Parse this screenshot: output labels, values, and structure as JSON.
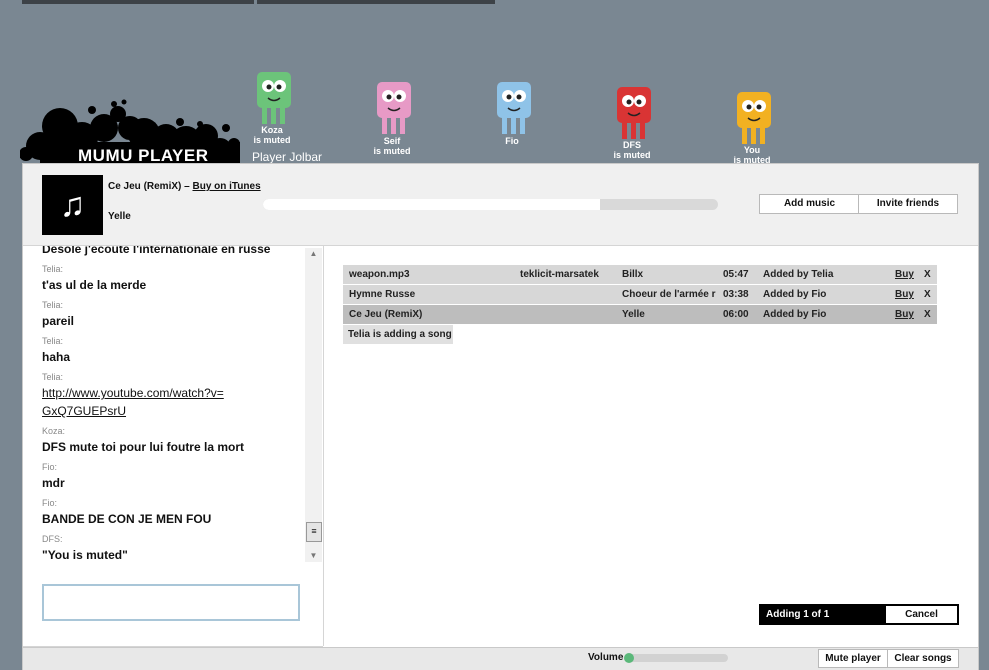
{
  "header": {
    "logo_text": "MUMU PLAYER",
    "room_name": "Player Jolbar"
  },
  "avatars": [
    {
      "name": "Koza",
      "status": "is muted",
      "color": "#6cc47a"
    },
    {
      "name": "Seif",
      "status": "is muted",
      "color": "#e79ac6"
    },
    {
      "name": "Fio",
      "status": "",
      "color": "#8fc3e8"
    },
    {
      "name": "DFS",
      "status": "is muted",
      "color": "#d93434"
    },
    {
      "name": "You",
      "status": "is muted",
      "color": "#f2b122"
    }
  ],
  "now_playing": {
    "track": "Ce Jeu (RemiX)",
    "separator": " – ",
    "buy_link": "Buy on iTunes",
    "artist": "Yelle",
    "album_icon": "music-note-icon",
    "progress": 0.74
  },
  "toolbar": {
    "add_music": "Add music",
    "invite_friends": "Invite friends"
  },
  "chat": {
    "messages": [
      {
        "author": "",
        "text": "Desole j'ecoute l'internationale en russe",
        "link": false
      },
      {
        "author": "Telia:",
        "text": "t'as ul de la merde",
        "link": false
      },
      {
        "author": "Telia:",
        "text": "pareil",
        "link": false
      },
      {
        "author": "Telia:",
        "text": "haha",
        "link": false
      },
      {
        "author": "Telia:",
        "text": "http://www.youtube.com/watch?v= GxQ7GUEPsrU",
        "link": true
      },
      {
        "author": "Koza:",
        "text": "DFS mute toi pour lui foutre la mort",
        "link": false
      },
      {
        "author": "Fio:",
        "text": "mdr",
        "link": false
      },
      {
        "author": "Fio:",
        "text": "BANDE DE CON JE MEN FOU",
        "link": false
      },
      {
        "author": "DFS:",
        "text": "\"You is muted\"",
        "link": false
      }
    ],
    "input_value": ""
  },
  "playlist": {
    "rows": [
      {
        "title": "weapon.mp3",
        "album": "teklicit-marsatek",
        "artist": "Billx",
        "time": "05:47",
        "added": "Added by Telia",
        "buy": "Buy",
        "remove": "X",
        "current": false
      },
      {
        "title": "Hymne Russe",
        "album": "",
        "artist": "Choeur de l'armée r",
        "time": "03:38",
        "added": "Added by Fio",
        "buy": "Buy",
        "remove": "X",
        "current": false
      },
      {
        "title": "Ce Jeu (RemiX)",
        "album": "",
        "artist": "Yelle",
        "time": "06:00",
        "added": "Added by Fio",
        "buy": "Buy",
        "remove": "X",
        "current": true
      }
    ],
    "adding_status": "Telia is adding a song"
  },
  "upload": {
    "status": "Adding 1 of 1",
    "cancel": "Cancel"
  },
  "footer": {
    "volume_label": "Volume",
    "volume": 0.0,
    "mute_player": "Mute player",
    "clear_songs": "Clear songs"
  }
}
